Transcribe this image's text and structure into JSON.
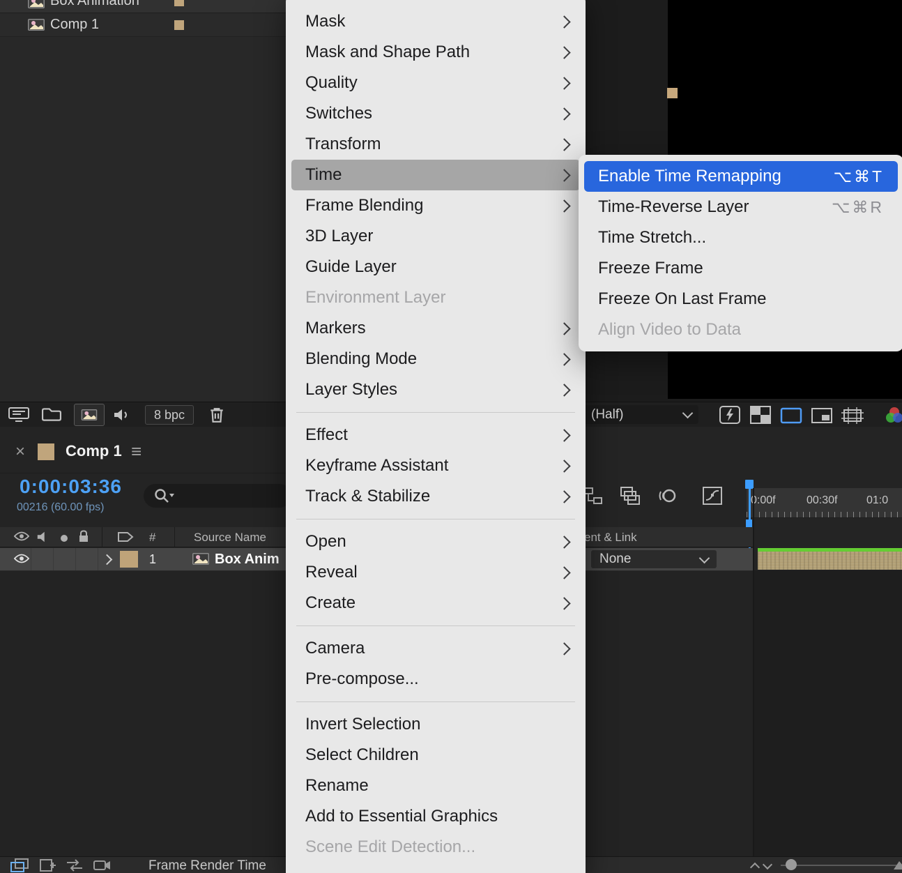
{
  "colors": {
    "selection_blue": "#2866dd",
    "open_item_gray": "#a6a6a6",
    "label_tan": "#c0a57c",
    "cti_blue": "#3c9dff",
    "green_bar": "#65cd33",
    "timecode_blue": "#4da1f5"
  },
  "project_panel": {
    "rows": [
      {
        "name": "Box Animation"
      },
      {
        "name": "Comp 1"
      }
    ],
    "toolbar": {
      "depth_label": "8 bpc"
    }
  },
  "viewer_toolbar": {
    "resolution": "(Half)"
  },
  "timeline": {
    "tab": {
      "close_glyph": "×",
      "title": "Comp 1",
      "menu_glyph": "≡"
    },
    "current_time": "0:00:03:36",
    "frame_info": "00216 (60.00 fps)",
    "columns": {
      "hash": "#",
      "source_name": "Source Name",
      "parent_link": "ent & Link"
    },
    "layer": {
      "index": "1",
      "name": "Box Anim",
      "parent": "None"
    },
    "ruler": {
      "ticks": [
        "0:00f",
        "00:30f",
        "01:0"
      ]
    },
    "status_bar": {
      "label": "Frame Render Time"
    }
  },
  "context_menu": {
    "items": [
      {
        "label": "Mask"
      },
      {
        "label": "Mask and Shape Path"
      },
      {
        "label": "Quality"
      },
      {
        "label": "Switches"
      },
      {
        "label": "Transform"
      },
      {
        "label": "Time"
      },
      {
        "label": "Frame Blending"
      },
      {
        "label": "3D Layer"
      },
      {
        "label": "Guide Layer"
      },
      {
        "label": "Environment Layer"
      },
      {
        "label": "Markers"
      },
      {
        "label": "Blending Mode"
      },
      {
        "label": "Layer Styles"
      },
      {
        "label": "Effect"
      },
      {
        "label": "Keyframe Assistant"
      },
      {
        "label": "Track & Stabilize"
      },
      {
        "label": "Open"
      },
      {
        "label": "Reveal"
      },
      {
        "label": "Create"
      },
      {
        "label": "Camera"
      },
      {
        "label": "Pre-compose..."
      },
      {
        "label": "Invert Selection"
      },
      {
        "label": "Select Children"
      },
      {
        "label": "Rename"
      },
      {
        "label": "Add to Essential Graphics"
      },
      {
        "label": "Scene Edit Detection..."
      }
    ]
  },
  "time_submenu": {
    "items": [
      {
        "label": "Enable Time Remapping",
        "shortcut": "⌥⌘T"
      },
      {
        "label": "Time-Reverse Layer",
        "shortcut": "⌥⌘R"
      },
      {
        "label": "Time Stretch..."
      },
      {
        "label": "Freeze Frame"
      },
      {
        "label": "Freeze On Last Frame"
      },
      {
        "label": "Align Video to Data"
      }
    ]
  }
}
